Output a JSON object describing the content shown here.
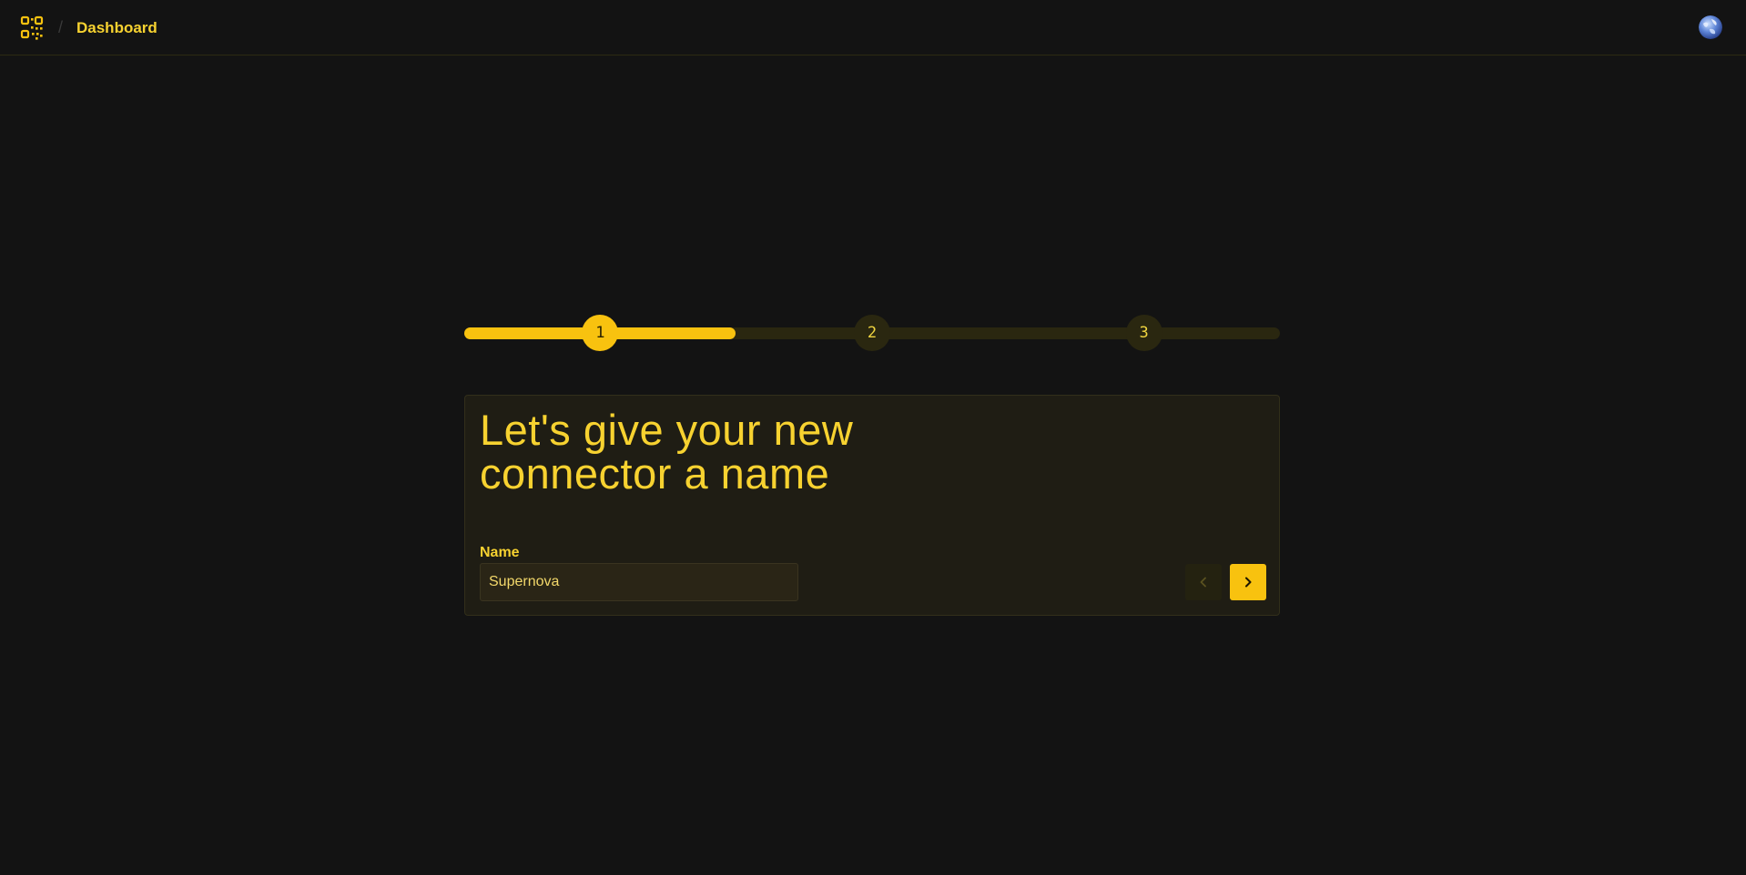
{
  "header": {
    "logo_icon": "qr-grid-logo-icon",
    "separator": "/",
    "breadcrumb": "Dashboard",
    "avatar_icon": "globe-avatar-icon"
  },
  "wizard": {
    "current_step": 1,
    "progress_fraction": 0.333,
    "steps": [
      {
        "label": "1",
        "state": "active"
      },
      {
        "label": "2",
        "state": "inactive"
      },
      {
        "label": "3",
        "state": "inactive"
      }
    ],
    "title": "Let's give your new connector a name",
    "field_label": "Name",
    "name_value": "Supernova",
    "prev_icon": "chevron-left-icon",
    "next_icon": "chevron-right-icon"
  },
  "colors": {
    "background": "#131313",
    "accent": "#f8c20f",
    "text_accent": "#f7d230",
    "card": "#1f1d14",
    "track": "#2a2710"
  }
}
